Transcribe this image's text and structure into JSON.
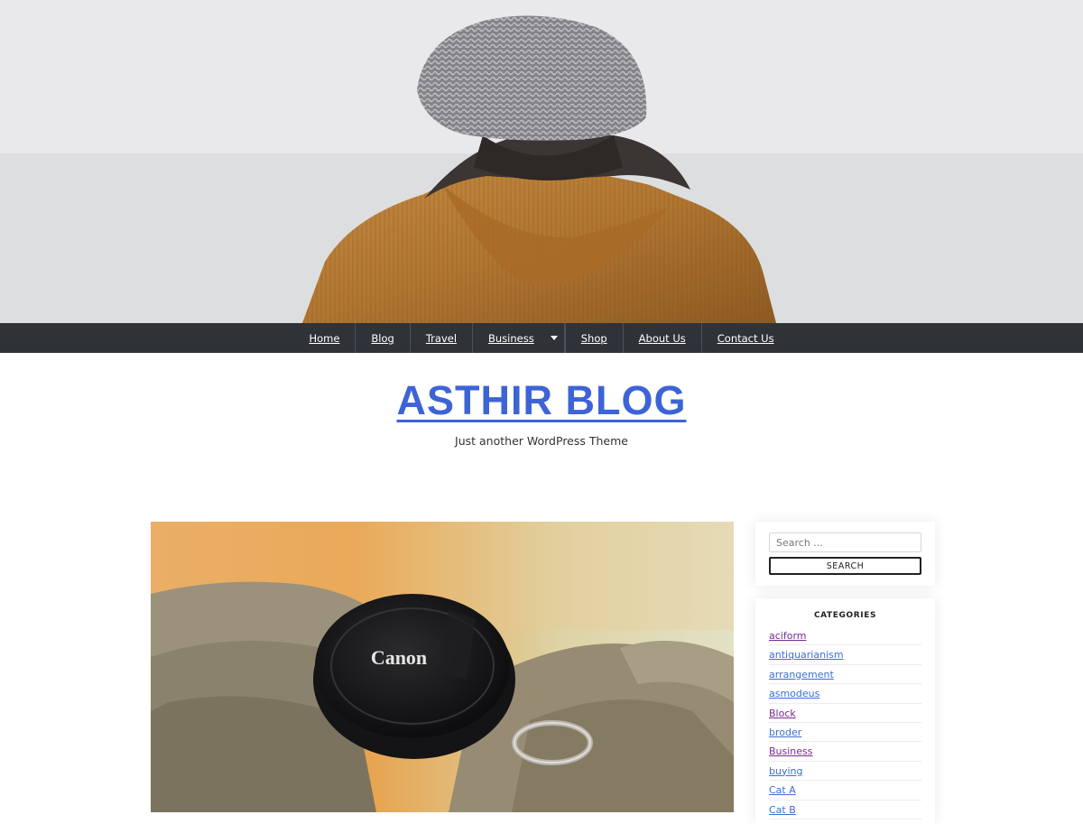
{
  "hero": {
    "alt": "Person wearing knit beanie and corduroy jacket"
  },
  "nav": {
    "items": [
      {
        "label": "Home"
      },
      {
        "label": "Blog"
      },
      {
        "label": "Travel"
      },
      {
        "label": "Business",
        "has_dropdown": true
      },
      {
        "label": "Shop"
      },
      {
        "label": "About Us"
      },
      {
        "label": "Contact Us"
      }
    ]
  },
  "branding": {
    "title": "ASTHIR BLOG",
    "tagline": "Just another WordPress Theme",
    "title_color": "#3d64d6"
  },
  "post": {
    "image_lens_text": "Canon"
  },
  "sidebar": {
    "search": {
      "placeholder": "Search ...",
      "button_label": "SEARCH"
    },
    "categories": {
      "title": "CATEGORIES",
      "items": [
        {
          "label": "aciform",
          "color": "#7a2a8c"
        },
        {
          "label": "antiquarianism",
          "color": "#3a6fd3"
        },
        {
          "label": "arrangement",
          "color": "#3a6fd3"
        },
        {
          "label": "asmodeus",
          "color": "#3a6fd3"
        },
        {
          "label": "Block",
          "color": "#7a2a8c"
        },
        {
          "label": "broder",
          "color": "#3a6fd3"
        },
        {
          "label": "Business",
          "color": "#7a2a8c"
        },
        {
          "label": "buying",
          "color": "#3a6fd3"
        },
        {
          "label": "Cat A",
          "color": "#3a6fd3"
        },
        {
          "label": "Cat B",
          "color": "#3a6fd3"
        }
      ]
    }
  }
}
